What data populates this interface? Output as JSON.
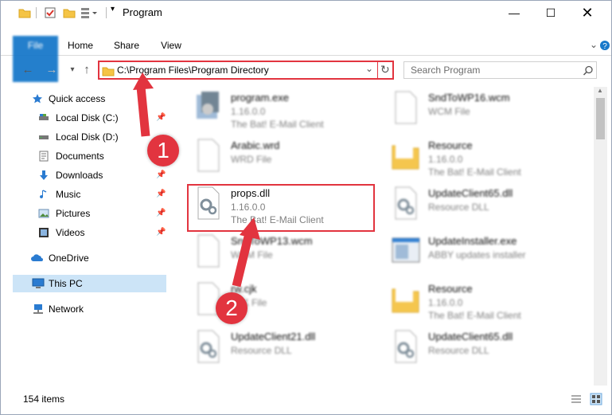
{
  "window": {
    "title": "Program"
  },
  "ribbon": {
    "tabs": [
      "File",
      "Home",
      "Share",
      "View"
    ]
  },
  "address": {
    "path": "C:\\Program Files\\Program Directory",
    "search_placeholder": "Search Program"
  },
  "sidebar": {
    "items": [
      {
        "label": "Quick access",
        "icon": "star-icon"
      },
      {
        "label": "Local Disk (C:)",
        "icon": "drive-icon"
      },
      {
        "label": "Local Disk (D:)",
        "icon": "drive-icon"
      },
      {
        "label": "Documents",
        "icon": "documents-icon"
      },
      {
        "label": "Downloads",
        "icon": "download-icon"
      },
      {
        "label": "Music",
        "icon": "music-icon"
      },
      {
        "label": "Pictures",
        "icon": "pictures-icon"
      },
      {
        "label": "Videos",
        "icon": "videos-icon"
      },
      {
        "label": "OneDrive",
        "icon": "cloud-icon"
      },
      {
        "label": "This PC",
        "icon": "computer-icon"
      },
      {
        "label": "Network",
        "icon": "network-icon"
      }
    ]
  },
  "files": [
    {
      "name": "program.exe",
      "line2": "1.16.0.0",
      "line3": "The Bat! E-Mail Client",
      "icon": "exe-icon"
    },
    {
      "name": "SndToWP16.wcm",
      "line2": "WCM File",
      "line3": "",
      "icon": "blank-file-icon"
    },
    {
      "name": "Arabic.wrd",
      "line2": "WRD File",
      "line3": "",
      "icon": "blank-file-icon"
    },
    {
      "name": "Resource",
      "line2": "1.16.0.0",
      "line3": "The Bat! E-Mail Client",
      "icon": "folder-icon"
    },
    {
      "name": "props.dll",
      "line2": "1.16.0.0",
      "line3": "The Bat! E-Mail Client",
      "icon": "dll-icon"
    },
    {
      "name": "UpdateClient65.dll",
      "line2": "Resource DLL",
      "line3": "",
      "icon": "dll-icon"
    },
    {
      "name": "SndToWP13.wcm",
      "line2": "WCM File",
      "line3": "",
      "icon": "blank-file-icon"
    },
    {
      "name": "UpdateInstaller.exe",
      "line2": "ABBY updates installer",
      "line3": "",
      "icon": "window-exe-icon"
    },
    {
      "name": "rw.cjk",
      "line2": "CJK File",
      "line3": "",
      "icon": "blank-file-icon"
    },
    {
      "name": "Resource",
      "line2": "1.16.0.0",
      "line3": "The Bat! E-Mail Client",
      "icon": "folder-icon"
    },
    {
      "name": "UpdateClient21.dll",
      "line2": "Resource DLL",
      "line3": "",
      "icon": "dll-icon"
    },
    {
      "name": "UpdateClient65.dll",
      "line2": "Resource DLL",
      "line3": "",
      "icon": "dll-icon"
    }
  ],
  "status": {
    "count": "154 items"
  },
  "annotations": {
    "step1": "1",
    "step2": "2"
  },
  "colors": {
    "accent": "#1979ca",
    "highlight": "#e2343f",
    "selection": "#cce4f7"
  }
}
